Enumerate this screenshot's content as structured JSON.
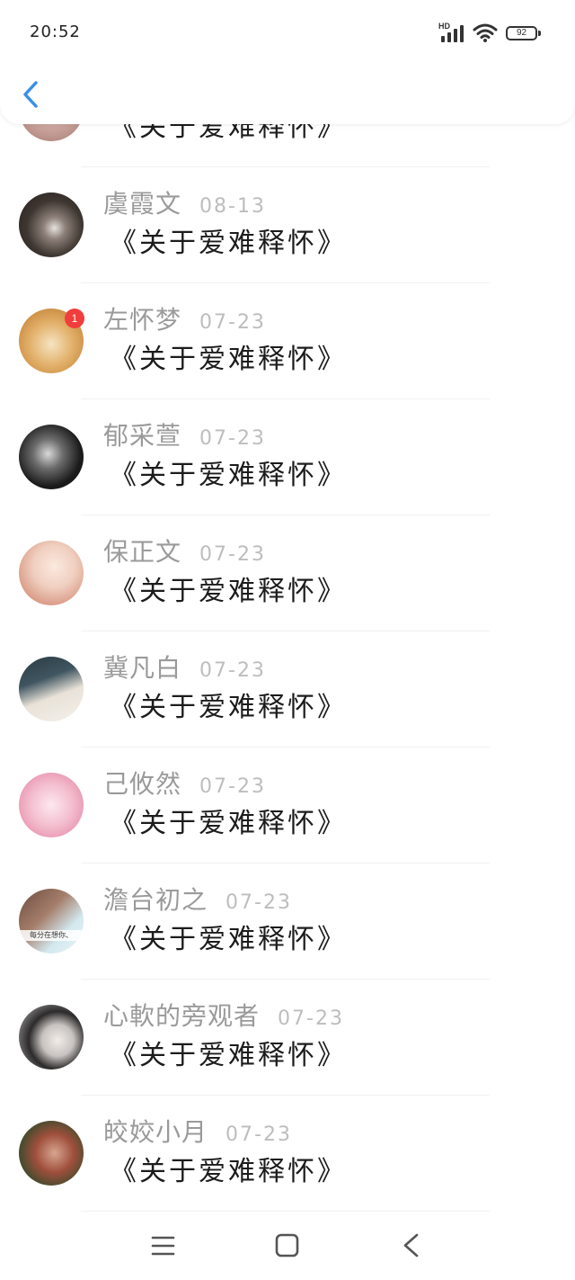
{
  "status_bar": {
    "time": "20:52",
    "network_label": "HD",
    "signal_icon": "signal-icon",
    "wifi_icon": "wifi-icon",
    "battery_level": "92"
  },
  "header": {
    "back_icon": "chevron-left-icon"
  },
  "colors": {
    "accent": "#3b8fe6",
    "badge": "#f23d3d",
    "name": "#9a9a9a",
    "date": "#bdbdbd",
    "message": "#1c1c1c"
  },
  "conversations": [
    {
      "message": "《关于爱难释怀》"
    },
    {
      "name": "虞霞文",
      "date": "08-13",
      "message": "《关于爱难释怀》"
    },
    {
      "name": "左怀梦",
      "date": "07-23",
      "message": "《关于爱难释怀》",
      "unread": "1"
    },
    {
      "name": "郁采萱",
      "date": "07-23",
      "message": "《关于爱难释怀》"
    },
    {
      "name": "保正文",
      "date": "07-23",
      "message": "《关于爱难释怀》"
    },
    {
      "name": "冀凡白",
      "date": "07-23",
      "message": "《关于爱难释怀》"
    },
    {
      "name": "己攸然",
      "date": "07-23",
      "message": "《关于爱难释怀》"
    },
    {
      "name": "澹台初之",
      "date": "07-23",
      "message": "《关于爱难释怀》",
      "avatar_caption": "每分在想你、"
    },
    {
      "name": "心軟的旁观者",
      "date": "07-23",
      "message": "《关于爱难释怀》"
    },
    {
      "name": "皎姣小月",
      "date": "07-23",
      "message": "《关于爱难释怀》"
    }
  ],
  "nav_bar": {
    "menu_icon": "menu-icon",
    "home_icon": "square-home-icon",
    "back_icon": "back-chevron-icon"
  }
}
